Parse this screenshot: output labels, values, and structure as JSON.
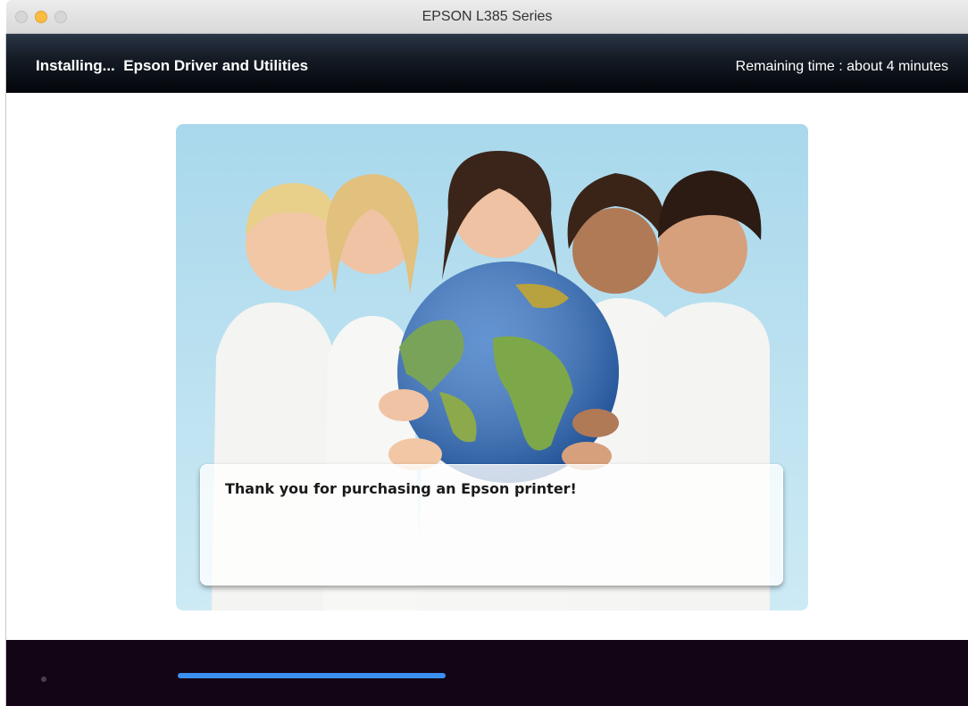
{
  "window": {
    "title": "EPSON L385 Series",
    "controls": [
      "close",
      "minimize",
      "maximize"
    ]
  },
  "header": {
    "status": "Installing...  Epson Driver and Utilities",
    "remaining_time": "Remaining time : about 4 minutes"
  },
  "slide": {
    "caption": "Thank you for purchasing an Epson printer!"
  },
  "footer": {
    "progress_fraction": 0.5
  },
  "colors": {
    "accent": "#3a8ff0",
    "header_bg": "#03050a",
    "footer_bg": "#130515",
    "minimize_button": "#fdbc40"
  }
}
